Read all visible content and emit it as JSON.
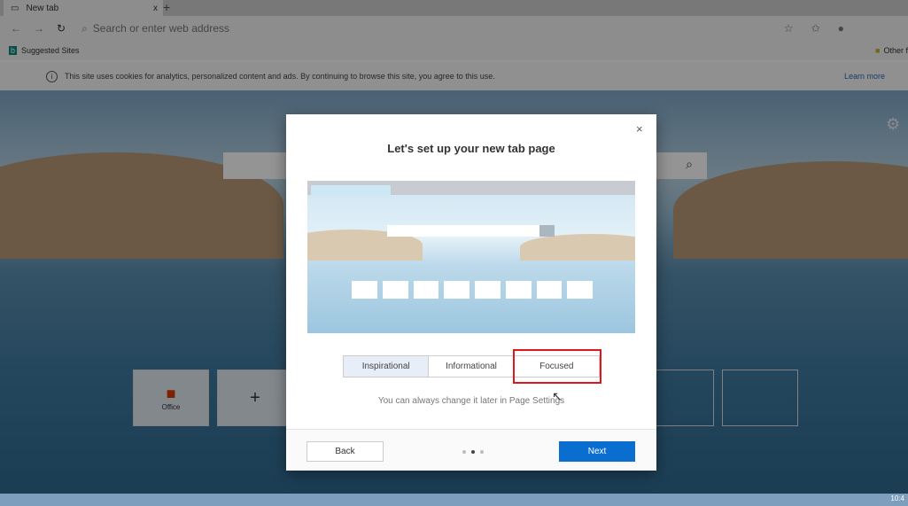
{
  "browser": {
    "tab_title": "New tab",
    "tab_close": "x",
    "new_tab": "+",
    "address_placeholder": "Search or enter web address",
    "favorites": {
      "suggested_sites": "Suggested Sites",
      "other_favorites": "Other f"
    }
  },
  "cookie_banner": {
    "text": "This site uses cookies for analytics, personalized content and ads. By continuing to browse this site, you agree to this use.",
    "learn_more": "Learn more"
  },
  "tiles": [
    {
      "label": "Office"
    },
    {
      "label": "+"
    }
  ],
  "dialog": {
    "title": "Let's set up your new tab page",
    "close": "×",
    "options": [
      "Inspirational",
      "Informational",
      "Focused"
    ],
    "selected": "Inspirational",
    "highlighted": "Focused",
    "hint": "You can always change it later in Page Settings",
    "back": "Back",
    "next": "Next",
    "step": 2,
    "steps": 3
  },
  "taskbar": {
    "clock": "10:4"
  },
  "colors": {
    "accent": "#0a6ed1",
    "highlight": "#e0161e"
  }
}
